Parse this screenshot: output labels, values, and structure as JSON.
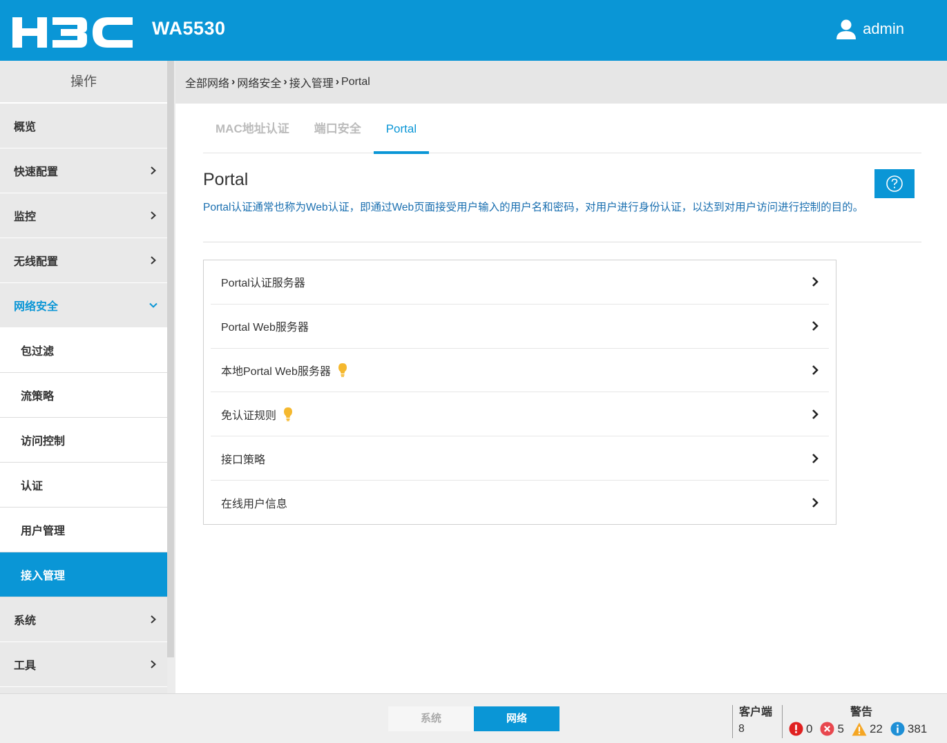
{
  "header": {
    "brand": "H3C",
    "model": "WA5530",
    "user": "admin"
  },
  "sidebar": {
    "title": "操作",
    "items": [
      {
        "label": "概览",
        "has_arrow": false
      },
      {
        "label": "快速配置",
        "has_arrow": true
      },
      {
        "label": "监控",
        "has_arrow": true
      },
      {
        "label": "无线配置",
        "has_arrow": true
      },
      {
        "label": "网络安全",
        "expanded": true
      }
    ],
    "subitems": [
      "包过滤",
      "流策略",
      "访问控制",
      "认证",
      "用户管理",
      "接入管理"
    ],
    "active_subitem": "接入管理",
    "items_after": [
      {
        "label": "系统"
      },
      {
        "label": "工具"
      }
    ]
  },
  "breadcrumb": [
    "全部网络",
    "网络安全",
    "接入管理",
    "Portal"
  ],
  "tabs": [
    "MAC地址认证",
    "端口安全",
    "Portal"
  ],
  "active_tab": "Portal",
  "page": {
    "title": "Portal",
    "description": "Portal认证通常也称为Web认证，即通过Web页面接受用户输入的用户名和密码，对用户进行身份认证，以达到对用户访问进行控制的目的。"
  },
  "menu": [
    {
      "label": "Portal认证服务器",
      "hint": false
    },
    {
      "label": "Portal Web服务器",
      "hint": false
    },
    {
      "label": "本地Portal Web服务器",
      "hint": true
    },
    {
      "label": "免认证规则",
      "hint": true
    },
    {
      "label": "接口策略",
      "hint": false
    },
    {
      "label": "在线用户信息",
      "hint": false
    }
  ],
  "footer": {
    "view_toggle": [
      "系统",
      "网络"
    ],
    "active_view": "网络",
    "clients_label": "客户端",
    "clients_count": "8",
    "alarms_label": "警告",
    "alarms": [
      {
        "type": "critical",
        "count": "0",
        "color": "#e02020"
      },
      {
        "type": "error",
        "count": "5",
        "color": "#e8474e"
      },
      {
        "type": "warning",
        "count": "22",
        "color": "#f5a623"
      },
      {
        "type": "info",
        "count": "381",
        "color": "#1e8fd6"
      }
    ]
  },
  "colors": {
    "accent": "#0a96d6",
    "hint_bulb": "#f5b82e"
  }
}
